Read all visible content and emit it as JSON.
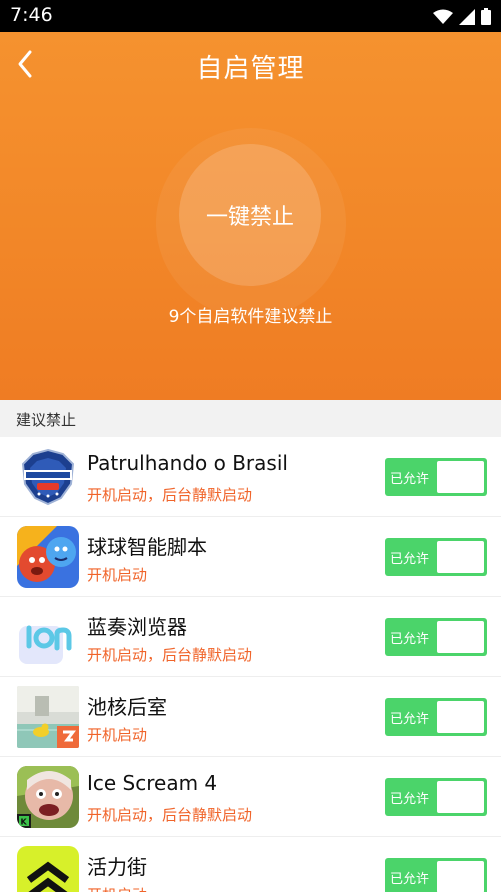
{
  "status_bar": {
    "time": "7:46"
  },
  "header": {
    "title": "自启管理",
    "main_button": "一键禁止",
    "subtitle": "9个自启软件建议禁止"
  },
  "section": {
    "label": "建议禁止"
  },
  "colors": {
    "hero_orange": "#f28728",
    "toggle_green": "#4bd46a",
    "description_orange": "#f0642a"
  },
  "apps": [
    {
      "name": "Patrulhando o Brasil",
      "desc": "开机启动，后台静默启动",
      "toggle_label": "已允许",
      "icon": "police-badge-icon"
    },
    {
      "name": "球球智能脚本",
      "desc": "开机启动",
      "toggle_label": "已允许",
      "icon": "game-characters-icon"
    },
    {
      "name": "蓝奏浏览器",
      "desc": "开机启动，后台静默启动",
      "toggle_label": "已允许",
      "icon": "lan-browser-icon"
    },
    {
      "name": "池核后室",
      "desc": "开机启动",
      "toggle_label": "已允许",
      "icon": "backrooms-pool-icon"
    },
    {
      "name": "Ice Scream 4",
      "desc": "开机启动，后台静默启动",
      "toggle_label": "已允许",
      "icon": "ice-scream-icon"
    },
    {
      "name": "活力街",
      "desc": "开机启动",
      "toggle_label": "已允许",
      "icon": "chevron-stack-icon"
    }
  ]
}
